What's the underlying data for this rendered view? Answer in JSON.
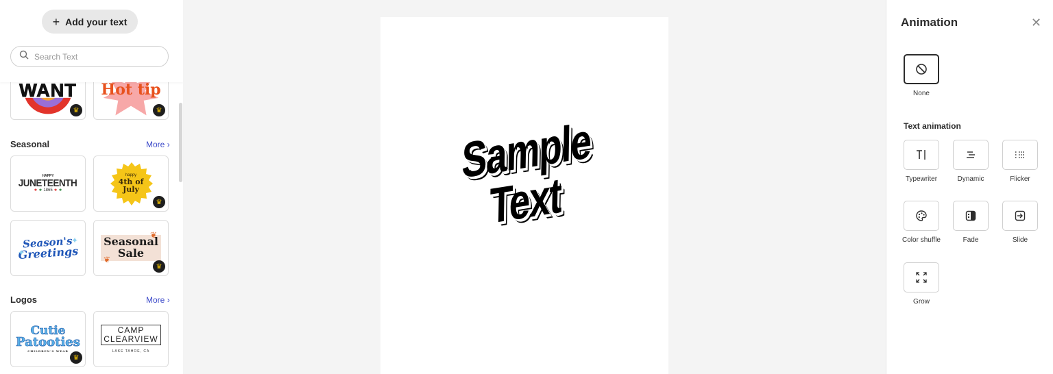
{
  "left_panel": {
    "add_text_label": "Add your text",
    "search_placeholder": "Search Text",
    "sections": [
      {
        "title": "Seasonal",
        "more": "More"
      },
      {
        "title": "Logos",
        "more": "More"
      }
    ],
    "cards": {
      "want": "WANT",
      "hot_tip": "Hot tip",
      "juneteenth_small": "HAPPY",
      "juneteenth": "JUNETEENTH",
      "juneteenth_year": "1865",
      "fourth_small": "happy",
      "fourth_line1": "4th of",
      "fourth_line2": "July",
      "seasons_line1": "Season's",
      "seasons_line2": "Greetings",
      "sale_line1": "Seasonal",
      "sale_line2": "Sale",
      "cutie_line1": "Cutie",
      "cutie_line2": "Patooties",
      "cutie_sub": "CHILDREN'S WEAR",
      "camp_line1": "CAMP",
      "camp_line2": "CLEARVIEW",
      "camp_sub": "LAKE TAHOE, CA"
    }
  },
  "canvas": {
    "sample_text": "Sample Text"
  },
  "animation_panel": {
    "title": "Animation",
    "close_icon": "close-icon",
    "none_label": "None",
    "section_title": "Text animation",
    "options": [
      {
        "label": "Typewriter",
        "icon": "typewriter-icon"
      },
      {
        "label": "Dynamic",
        "icon": "dynamic-icon"
      },
      {
        "label": "Flicker",
        "icon": "flicker-icon"
      },
      {
        "label": "Color shuffle",
        "icon": "palette-icon"
      },
      {
        "label": "Fade",
        "icon": "fade-icon"
      },
      {
        "label": "Slide",
        "icon": "slide-icon"
      },
      {
        "label": "Grow",
        "icon": "grow-icon"
      }
    ],
    "selected": "None"
  },
  "colors": {
    "accent_link": "#3b49c9",
    "crown_gold": "#f5c400",
    "panel_bg": "#f4f4f4"
  }
}
